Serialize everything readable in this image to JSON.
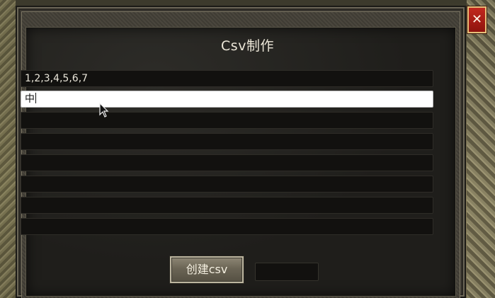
{
  "dialog": {
    "title": "Csv制作",
    "rows": [
      {
        "value": "1,2,3,4,5,6,7"
      },
      {
        "value": "中"
      },
      {
        "value": ""
      },
      {
        "value": ""
      },
      {
        "value": ""
      },
      {
        "value": ""
      },
      {
        "value": ""
      },
      {
        "value": ""
      }
    ],
    "active_row_index": 1,
    "create_button_label": "创建csv",
    "close_label": "✕"
  },
  "colors": {
    "close_button": "#c2281e",
    "row_background": "#12110f",
    "active_row_background": "#ffffff",
    "title_text": "#ece7d8"
  }
}
